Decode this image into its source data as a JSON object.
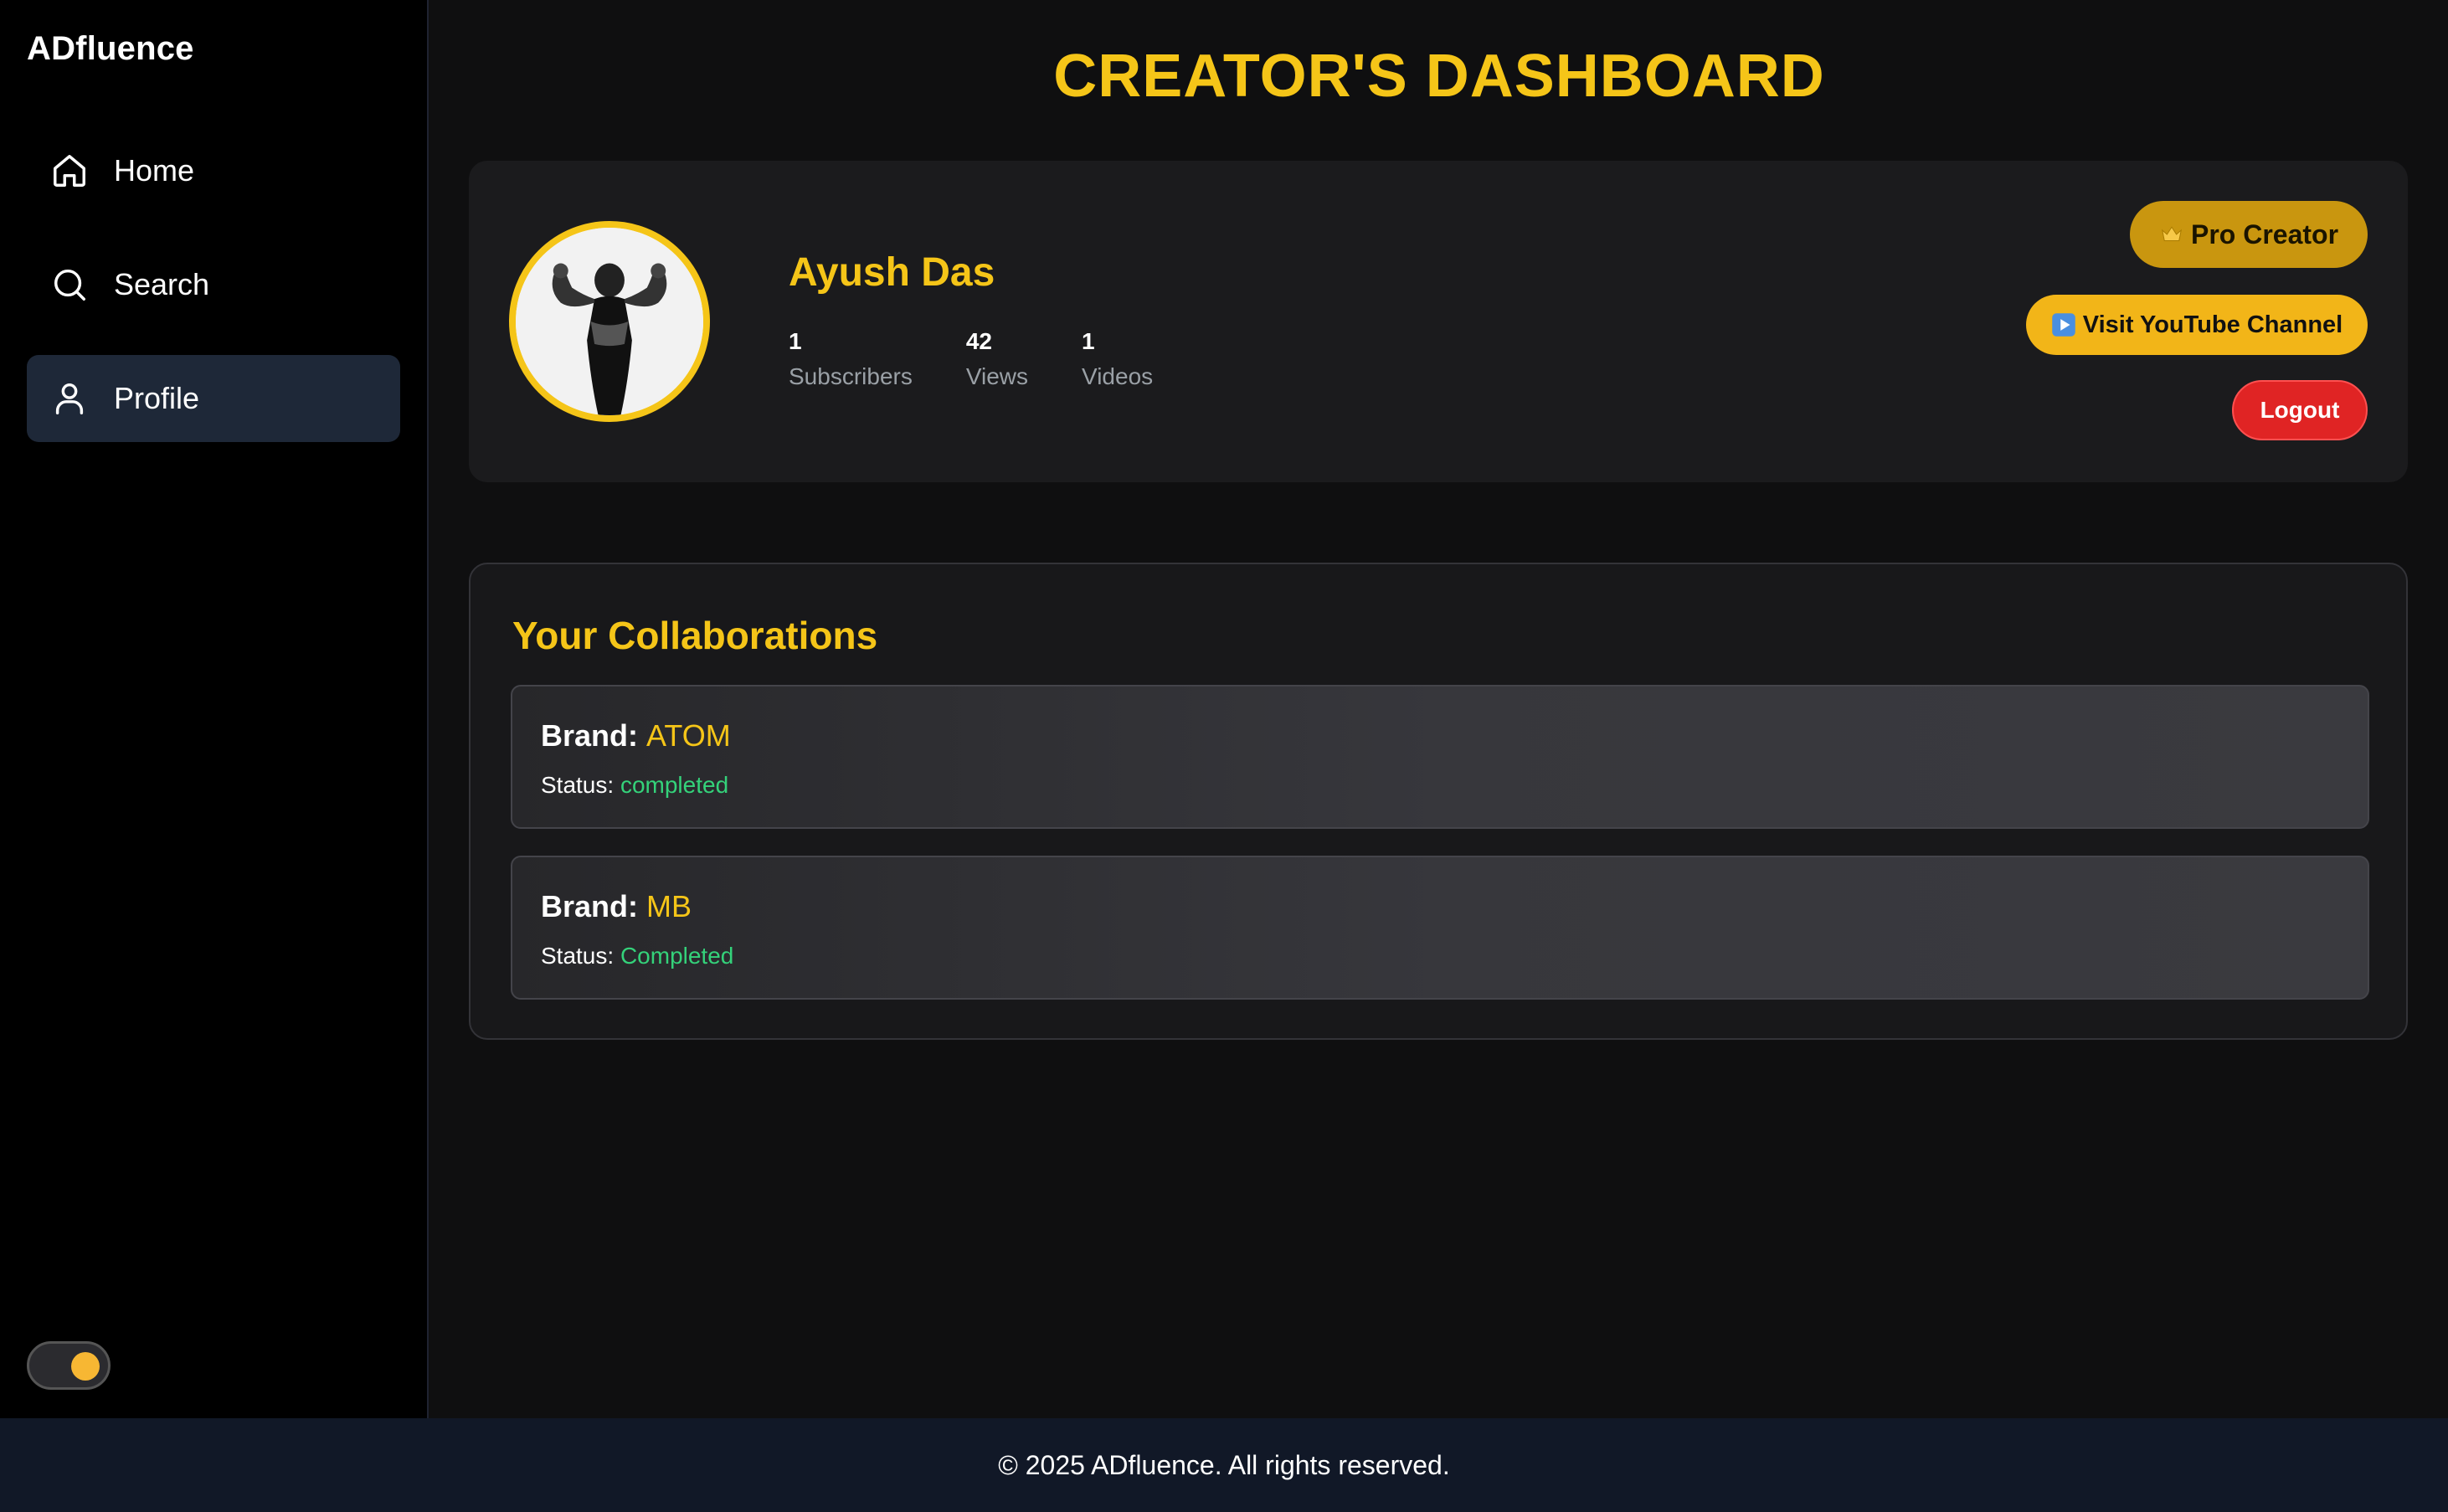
{
  "sidebar": {
    "brand": "ADfluence",
    "items": [
      {
        "label": "Home",
        "icon": "home-icon"
      },
      {
        "label": "Search",
        "icon": "search-icon"
      },
      {
        "label": "Profile",
        "icon": "user-icon",
        "active": true
      }
    ],
    "theme_toggle": {
      "state": "on",
      "knob_color": "#f7b733"
    }
  },
  "header": {
    "title": "CREATOR'S DASHBOARD"
  },
  "profile": {
    "name": "Ayush Das",
    "avatar_icon": "avatar-image",
    "stats": [
      {
        "value": "1",
        "label": "Subscribers"
      },
      {
        "value": "42",
        "label": "Views"
      },
      {
        "value": "1",
        "label": "Videos"
      }
    ],
    "pro_label": "Pro Creator",
    "pro_icon": "crown-icon",
    "youtube_label": "Visit YouTube Channel",
    "youtube_icon": "play-button-icon",
    "logout_label": "Logout"
  },
  "collaborations": {
    "title": "Your Collaborations",
    "brand_prefix": "Brand:",
    "status_prefix": "Status:",
    "items": [
      {
        "brand": "ATOM",
        "status": "completed"
      },
      {
        "brand": "MB",
        "status": "Completed"
      }
    ]
  },
  "footer": {
    "text": "© 2025 ADfluence. All rights reserved."
  },
  "colors": {
    "accent": "#f5c518",
    "status_green": "#34d27a",
    "logout_red": "#e02424",
    "sidebar_active": "#1e2838"
  }
}
